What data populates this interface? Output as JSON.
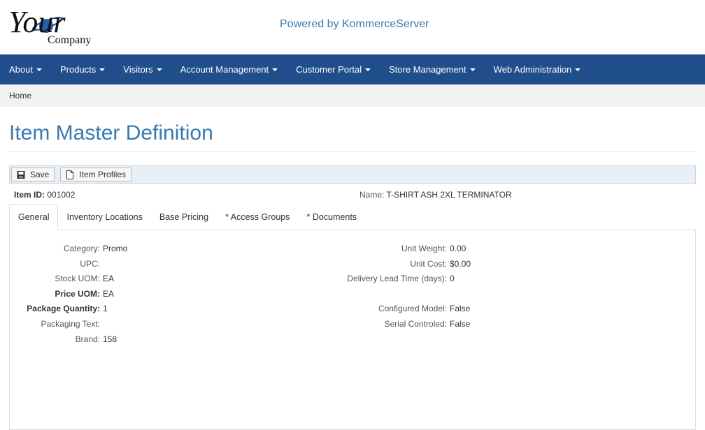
{
  "header": {
    "logo": {
      "word1": "Your",
      "word2": "Company"
    },
    "powered_by": "Powered by KommerceServer"
  },
  "nav": [
    {
      "label": "About"
    },
    {
      "label": "Products"
    },
    {
      "label": "Visitors"
    },
    {
      "label": "Account Management"
    },
    {
      "label": "Customer Portal"
    },
    {
      "label": "Store Management"
    },
    {
      "label": "Web Administration"
    }
  ],
  "breadcrumb": {
    "home": "Home"
  },
  "page": {
    "title": "Item Master Definition"
  },
  "toolbar": {
    "save_label": "Save",
    "profiles_label": "Item Profiles"
  },
  "item": {
    "id_label": "Item ID:",
    "id_value": "001002",
    "name_label": "Name:",
    "name_value": "T-SHIRT ASH 2XL TERMINATOR"
  },
  "tabs": [
    {
      "label": "General"
    },
    {
      "label": "Inventory Locations"
    },
    {
      "label": "Base Pricing"
    },
    {
      "label": "* Access Groups"
    },
    {
      "label": "* Documents"
    }
  ],
  "general": {
    "left": [
      {
        "label": "Category:",
        "value": "Promo"
      },
      {
        "label": "UPC:",
        "value": ""
      },
      {
        "label": "Stock UOM:",
        "value": "EA"
      },
      {
        "label": "Price UOM:",
        "value": "EA"
      },
      {
        "label": "Package Quantity:",
        "value": "1"
      },
      {
        "label": "Packaging Text:",
        "value": ""
      },
      {
        "label": "Brand:",
        "value": "158"
      }
    ],
    "right": [
      {
        "label": "Unit Weight:",
        "value": "0.00"
      },
      {
        "label": "Unit Cost:",
        "value": "$0.00"
      },
      {
        "label": "Delivery Lead Time (days):",
        "value": "0"
      },
      {
        "label": "",
        "value": ""
      },
      {
        "label": "Configured Model:",
        "value": "False"
      },
      {
        "label": "Serial Controled:",
        "value": "False"
      }
    ]
  },
  "colors": {
    "brand_blue": "#1f4e8a",
    "title_blue": "#3a7ab0"
  }
}
